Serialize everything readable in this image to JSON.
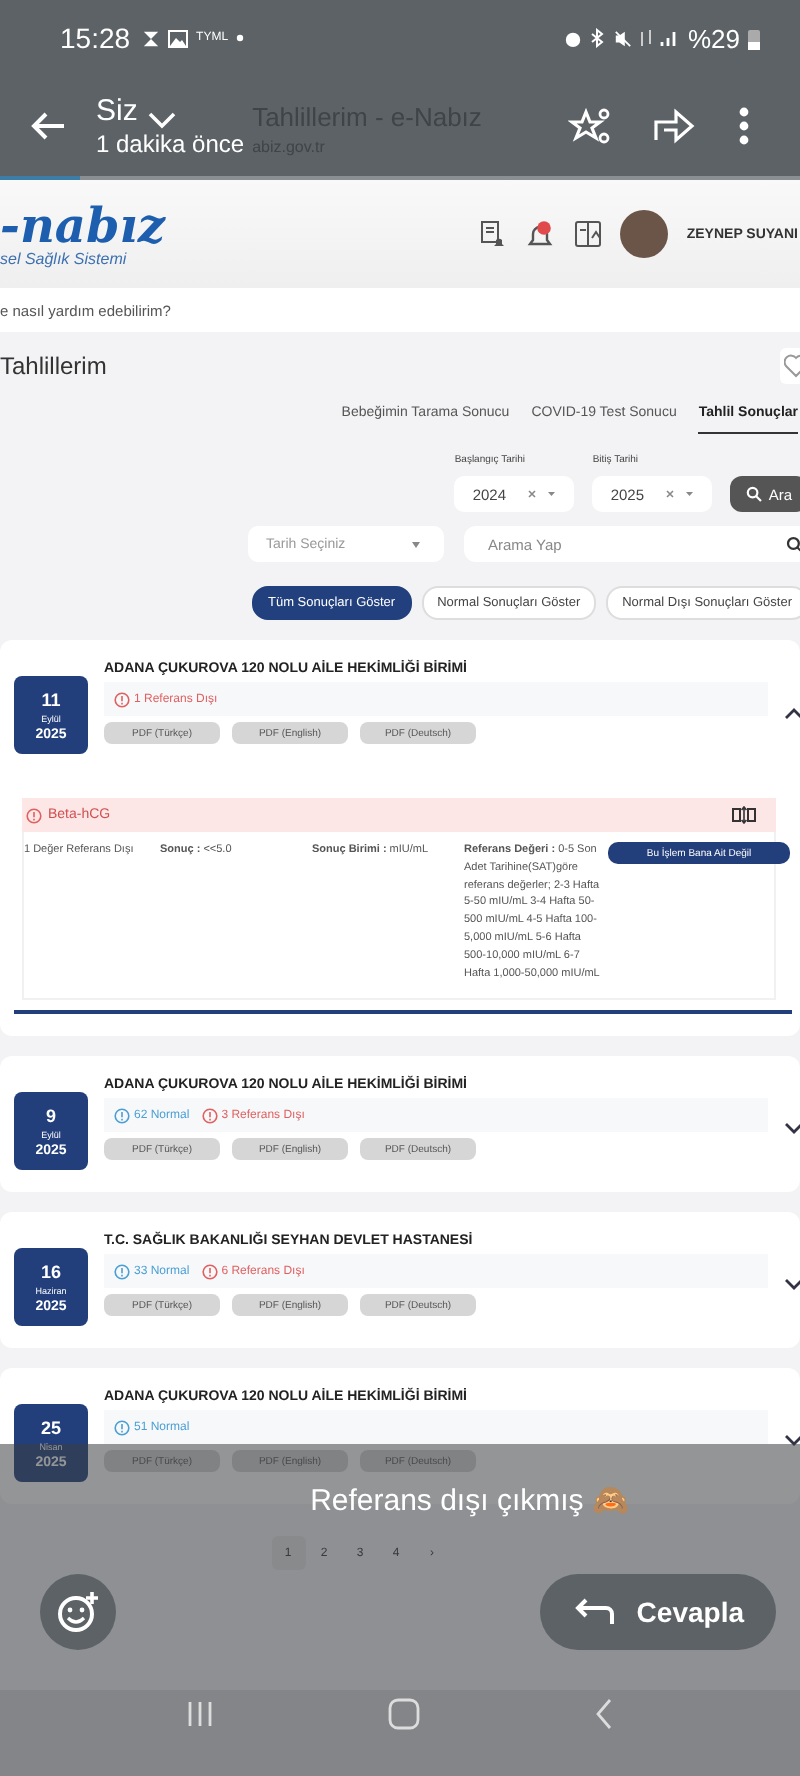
{
  "status_bar": {
    "time": "15:28",
    "carrier": "TYML",
    "battery": "%29"
  },
  "story_header": {
    "author": "Siz",
    "time_ago": "1 dakika önce",
    "page_title": "Tahlillerim - e-Nabız",
    "page_url": "abiz.gov.tr"
  },
  "story_progress": {
    "level": 0.1
  },
  "site_header": {
    "logo": "-nabız",
    "logo_subtitle": "sel Sağlık Sistemi",
    "user_name": "ZEYNEP SUYANI"
  },
  "help_search": {
    "placeholder": "e nasıl yardım edebilirim?"
  },
  "page_title": "Tahlillerim",
  "tabs": [
    {
      "label": "Bebeğimin Tarama Sonucu",
      "selected": false
    },
    {
      "label": "COVID-19 Test Sonucu",
      "selected": false
    },
    {
      "label": "Tahlil Sonuçlar",
      "selected": true
    }
  ],
  "date_filters": {
    "start_label": "Başlangıç Tarihi",
    "start_value": "2024",
    "end_label": "Bitiş Tarihi",
    "end_value": "2025",
    "search_button": "Ara"
  },
  "date_select": {
    "placeholder": "Tarih Seçiniz"
  },
  "search": {
    "placeholder": "Arama Yap"
  },
  "result_filters": [
    {
      "label": "Tüm Sonuçları Göster",
      "selected": true
    },
    {
      "label": "Normal Sonuçları Göster",
      "selected": false
    },
    {
      "label": "Normal Dışı Sonuçları Göster",
      "selected": false
    }
  ],
  "results": [
    {
      "day": "11",
      "month": "Eylül",
      "year": "2025",
      "institution": "ADANA ÇUKUROVA 120 NOLU AİLE HEKİMLİĞİ BİRİMİ",
      "expanded": true,
      "summary": [
        {
          "kind": "out_of_range",
          "text": "1 Referans Dışı"
        }
      ],
      "pdfs": [
        "PDF (Türkçe)",
        "PDF (English)",
        "PDF (Deutsch)"
      ],
      "details": [
        {
          "test": "Beta-hCG",
          "status": "1 Değer Referans Dışı",
          "result": "**Sonuç :** <<5.0",
          "unit": "**Sonuç Birimi :** mIU/mL",
          "reference": "**Referans Değeri :** 0-5 Son Adet Tarihine(SAT)göre referans değerler; 2-3 Hafta 5-50 mIU/mL 3-4 Hafta 50-500 mIU/mL 4-5 Hafta 100-5,000 mIU/mL 5-6 Hafta 500-10,000 mIU/mL 6-7 Hafta 1,000-50,000 mIU/mL",
          "action": "Bu İşlem Bana Ait Değil"
        }
      ]
    },
    {
      "day": "9",
      "month": "Eylül",
      "year": "2025",
      "institution": "ADANA ÇUKUROVA 120 NOLU AİLE HEKİMLİĞİ BİRİMİ",
      "expanded": false,
      "summary": [
        {
          "kind": "normal",
          "text": "62 Normal"
        },
        {
          "kind": "out_of_range",
          "text": "3 Referans Dışı"
        }
      ],
      "pdfs": [
        "PDF (Türkçe)",
        "PDF (English)",
        "PDF (Deutsch)"
      ]
    },
    {
      "day": "16",
      "month": "Haziran",
      "year": "2025",
      "institution": "T.C. SAĞLIK BAKANLIĞI SEYHAN DEVLET HASTANESİ",
      "expanded": false,
      "summary": [
        {
          "kind": "normal",
          "text": "33 Normal"
        },
        {
          "kind": "out_of_range",
          "text": "6 Referans Dışı"
        }
      ],
      "pdfs": [
        "PDF (Türkçe)",
        "PDF (English)",
        "PDF (Deutsch)"
      ]
    },
    {
      "day": "25",
      "month": "Nisan",
      "year": "2025",
      "institution": "ADANA ÇUKUROVA 120 NOLU AİLE HEKİMLİĞİ BİRİMİ",
      "expanded": false,
      "summary": [
        {
          "kind": "normal",
          "text": "51 Normal"
        }
      ],
      "pdfs": [
        "PDF (Türkçe)",
        "PDF (English)",
        "PDF (Deutsch)"
      ]
    }
  ],
  "pagination": {
    "pages": [
      {
        "label": "1",
        "selected": true
      },
      {
        "label": "2",
        "selected": false
      },
      {
        "label": "3",
        "selected": false
      },
      {
        "label": "4",
        "selected": false
      }
    ],
    "next": "›"
  },
  "story_footer": {
    "caption": "Referans dışı çıkmış 🙈",
    "reply_button": "Cevapla"
  }
}
